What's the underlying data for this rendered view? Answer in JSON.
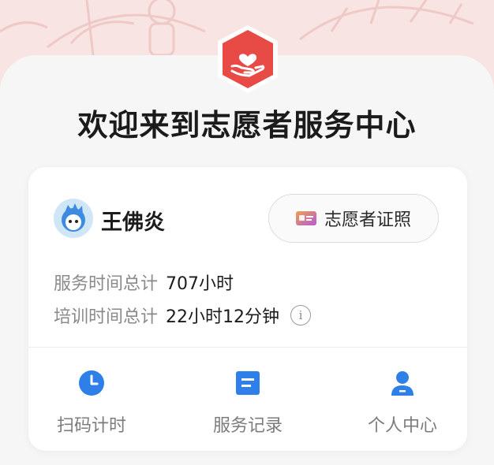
{
  "header": {
    "title": "欢迎来到志愿者服务中心",
    "logo_icon": "heart-in-hand-icon",
    "accent_color": "#e84a45"
  },
  "profile": {
    "name": "王佛炎",
    "avatar_icon": "cartoon-avatar-icon",
    "certificate_button_label": "志愿者证照"
  },
  "stats": {
    "service_time_label": "服务时间总计",
    "service_time_value": "707小时",
    "training_time_label": "培训时间总计",
    "training_time_value": "22小时12分钟",
    "info_icon": "info-icon"
  },
  "bottom_nav": [
    {
      "label": "扫码计时",
      "icon": "clock-icon"
    },
    {
      "label": "服务记录",
      "icon": "document-icon"
    },
    {
      "label": "个人中心",
      "icon": "person-icon"
    }
  ],
  "colors": {
    "nav_icon": "#2f7fe8",
    "hero_background": "#f8e4e2"
  }
}
